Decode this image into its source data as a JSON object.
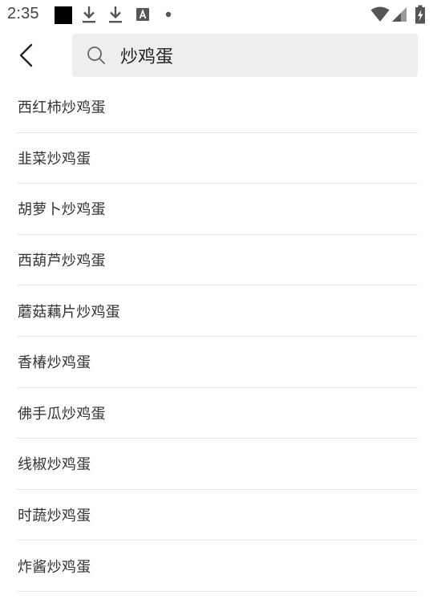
{
  "status_bar": {
    "time": "2:35",
    "icons": [
      "notification-square-icon",
      "download-icon",
      "download-icon",
      "font-icon",
      "dot-icon",
      "wifi-icon",
      "signal-icon",
      "battery-charging-icon"
    ]
  },
  "header": {
    "back_icon": "chevron-left-icon",
    "search": {
      "icon": "search-icon",
      "value": "炒鸡蛋",
      "placeholder": ""
    }
  },
  "results": [
    {
      "label": "西红柿炒鸡蛋"
    },
    {
      "label": "韭菜炒鸡蛋"
    },
    {
      "label": "胡萝卜炒鸡蛋"
    },
    {
      "label": "西葫芦炒鸡蛋"
    },
    {
      "label": "蘑菇藕片炒鸡蛋"
    },
    {
      "label": "香椿炒鸡蛋"
    },
    {
      "label": "佛手瓜炒鸡蛋"
    },
    {
      "label": "线椒炒鸡蛋"
    },
    {
      "label": "时蔬炒鸡蛋"
    },
    {
      "label": "炸酱炒鸡蛋"
    }
  ],
  "colors": {
    "background": "#ffffff",
    "search_bg": "#eeeeee",
    "divider": "#e6e6e6",
    "text": "#333333"
  }
}
